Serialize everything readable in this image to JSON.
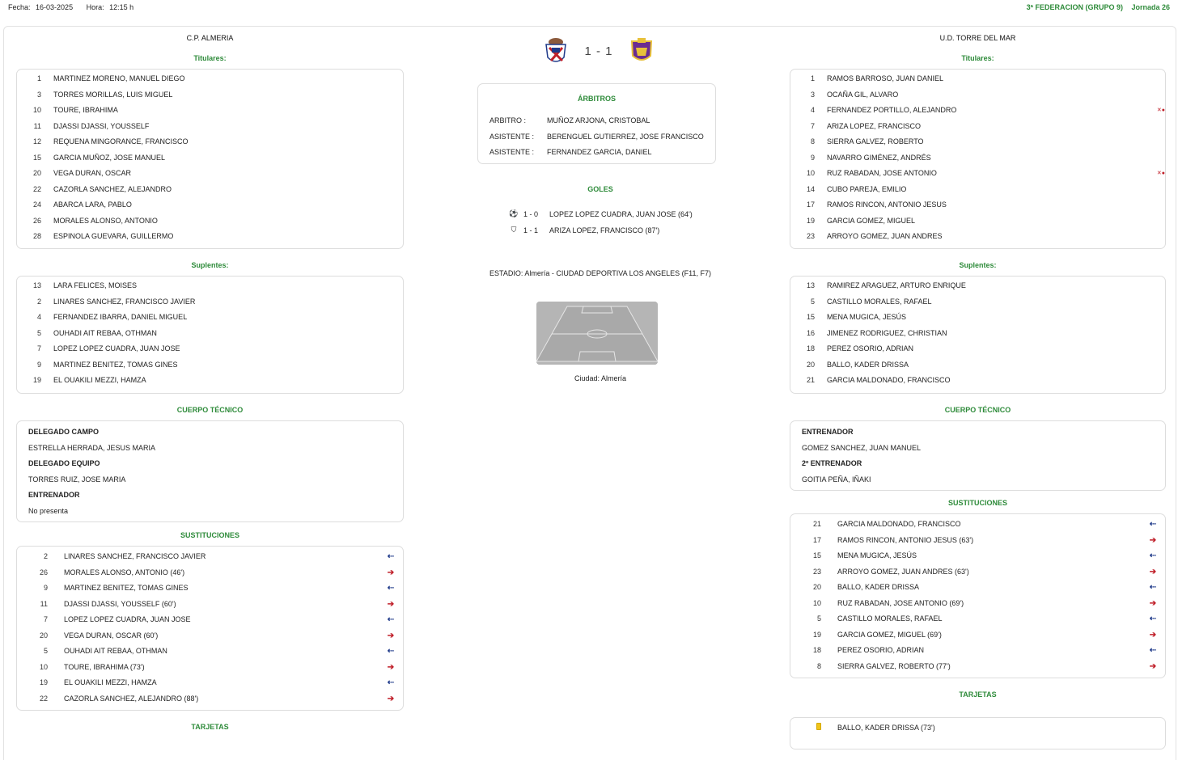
{
  "header": {
    "fecha_label": "Fecha:",
    "fecha": "16-03-2025",
    "hora_label": "Hora:",
    "hora": "12:15 h",
    "competition": "3ª FEDERACION (GRUPO 9)",
    "jornada": "Jornada 26"
  },
  "match": {
    "home_team": "C.P. ALMERIA",
    "away_team": "U.D. TORRE DEL MAR",
    "score": "1 - 1"
  },
  "labels": {
    "titulares": "Titulares:",
    "suplentes": "Suplentes:",
    "cuerpo_tecnico": "CUERPO TÉCNICO",
    "sustituciones": "SUSTITUCIONES",
    "tarjetas": "TARJETAS",
    "arbitros": "ÁRBITROS",
    "goles": "GOLES"
  },
  "home": {
    "starters": [
      {
        "num": "1",
        "name": "MARTINEZ MORENO, MANUEL DIEGO"
      },
      {
        "num": "3",
        "name": "TORRES MORILLAS, LUIS MIGUEL"
      },
      {
        "num": "10",
        "name": "TOURE, IBRAHIMA"
      },
      {
        "num": "11",
        "name": "DJASSI DJASSI, YOUSSELF"
      },
      {
        "num": "12",
        "name": "REQUENA MINGORANCE, FRANCISCO"
      },
      {
        "num": "15",
        "name": "GARCIA MUÑOZ, JOSE MANUEL"
      },
      {
        "num": "20",
        "name": "VEGA DURAN, OSCAR"
      },
      {
        "num": "22",
        "name": "CAZORLA SANCHEZ, ALEJANDRO"
      },
      {
        "num": "24",
        "name": "ABARCA LARA, PABLO"
      },
      {
        "num": "26",
        "name": "MORALES ALONSO, ANTONIO"
      },
      {
        "num": "28",
        "name": "ESPINOLA GUEVARA, GUILLERMO"
      }
    ],
    "subs": [
      {
        "num": "13",
        "name": "LARA FELICES, MOISES"
      },
      {
        "num": "2",
        "name": "LINARES SANCHEZ, FRANCISCO JAVIER"
      },
      {
        "num": "4",
        "name": "FERNANDEZ IBARRA, DANIEL MIGUEL"
      },
      {
        "num": "5",
        "name": "OUHADI AIT REBAA, OTHMAN"
      },
      {
        "num": "7",
        "name": "LOPEZ LOPEZ CUADRA, JUAN JOSE"
      },
      {
        "num": "9",
        "name": "MARTINEZ BENITEZ, TOMAS GINES"
      },
      {
        "num": "19",
        "name": "EL OUAKILI MEZZI, HAMZA"
      }
    ],
    "staff": [
      {
        "role": "DELEGADO CAMPO",
        "name": "ESTRELLA HERRADA, JESUS MARIA"
      },
      {
        "role": "DELEGADO EQUIPO",
        "name": "TORRES RUIZ, JOSE MARIA"
      },
      {
        "role": "ENTRENADOR",
        "name": "No presenta"
      }
    ],
    "substitutions": [
      {
        "num": "2",
        "name": "LINARES SANCHEZ, FRANCISCO JAVIER",
        "dir": "in",
        "arrow": "⇠"
      },
      {
        "num": "26",
        "name": "MORALES ALONSO, ANTONIO (46')",
        "dir": "out",
        "arrow": "➔"
      },
      {
        "num": "9",
        "name": "MARTINEZ BENITEZ, TOMAS GINES",
        "dir": "in",
        "arrow": "⇠"
      },
      {
        "num": "11",
        "name": "DJASSI DJASSI, YOUSSELF (60')",
        "dir": "out",
        "arrow": "➔"
      },
      {
        "num": "7",
        "name": "LOPEZ LOPEZ CUADRA, JUAN JOSE",
        "dir": "in",
        "arrow": "⇠"
      },
      {
        "num": "20",
        "name": "VEGA DURAN, OSCAR (60')",
        "dir": "out",
        "arrow": "➔"
      },
      {
        "num": "5",
        "name": "OUHADI AIT REBAA, OTHMAN",
        "dir": "in",
        "arrow": "⇠"
      },
      {
        "num": "10",
        "name": "TOURE, IBRAHIMA (73')",
        "dir": "out",
        "arrow": "➔"
      },
      {
        "num": "19",
        "name": "EL OUAKILI MEZZI, HAMZA",
        "dir": "in",
        "arrow": "⇠"
      },
      {
        "num": "22",
        "name": "CAZORLA SANCHEZ, ALEJANDRO (88')",
        "dir": "out",
        "arrow": "➔"
      }
    ]
  },
  "away": {
    "starters": [
      {
        "num": "1",
        "name": "RAMOS BARROSO, JUAN DANIEL"
      },
      {
        "num": "3",
        "name": "OCAÑA GIL, ALVARO"
      },
      {
        "num": "4",
        "name": "FERNANDEZ PORTILLO, ALEJANDRO",
        "icon": "captain-icon"
      },
      {
        "num": "7",
        "name": "ARIZA LOPEZ, FRANCISCO"
      },
      {
        "num": "8",
        "name": "SIERRA GALVEZ, ROBERTO"
      },
      {
        "num": "9",
        "name": "NAVARRO GIMÉNEZ, ANDRÉS"
      },
      {
        "num": "10",
        "name": "RUZ RABADAN, JOSE ANTONIO",
        "icon": "captain-icon"
      },
      {
        "num": "14",
        "name": "CUBO PAREJA, EMILIO"
      },
      {
        "num": "17",
        "name": "RAMOS RINCON, ANTONIO JESUS"
      },
      {
        "num": "19",
        "name": "GARCIA GOMEZ, MIGUEL"
      },
      {
        "num": "23",
        "name": "ARROYO GOMEZ, JUAN ANDRES"
      }
    ],
    "subs": [
      {
        "num": "13",
        "name": "RAMIREZ ARAGUEZ, ARTURO ENRIQUE"
      },
      {
        "num": "5",
        "name": "CASTILLO MORALES, RAFAEL"
      },
      {
        "num": "15",
        "name": "MENA MUGICA, JESÚS"
      },
      {
        "num": "16",
        "name": "JIMENEZ RODRIGUEZ, CHRISTIAN"
      },
      {
        "num": "18",
        "name": "PEREZ OSORIO, ADRIAN"
      },
      {
        "num": "20",
        "name": "BALLO, KADER DRISSA"
      },
      {
        "num": "21",
        "name": "GARCIA MALDONADO, FRANCISCO"
      }
    ],
    "staff": [
      {
        "role": "ENTRENADOR",
        "name": "GOMEZ SANCHEZ, JUAN MANUEL"
      },
      {
        "role": "2º ENTRENADOR",
        "name": "GOITIA PEÑA, IÑAKI"
      }
    ],
    "substitutions": [
      {
        "num": "21",
        "name": "GARCIA MALDONADO, FRANCISCO",
        "dir": "in",
        "arrow": "⇠"
      },
      {
        "num": "17",
        "name": "RAMOS RINCON, ANTONIO JESUS (63')",
        "dir": "out",
        "arrow": "➔"
      },
      {
        "num": "15",
        "name": "MENA MUGICA, JESÚS",
        "dir": "in",
        "arrow": "⇠"
      },
      {
        "num": "23",
        "name": "ARROYO GOMEZ, JUAN ANDRES (63')",
        "dir": "out",
        "arrow": "➔"
      },
      {
        "num": "20",
        "name": "BALLO, KADER DRISSA",
        "dir": "in",
        "arrow": "⇠"
      },
      {
        "num": "10",
        "name": "RUZ RABADAN, JOSE ANTONIO (69')",
        "dir": "out",
        "arrow": "➔"
      },
      {
        "num": "5",
        "name": "CASTILLO MORALES, RAFAEL",
        "dir": "in",
        "arrow": "⇠"
      },
      {
        "num": "19",
        "name": "GARCIA GOMEZ, MIGUEL (69')",
        "dir": "out",
        "arrow": "➔"
      },
      {
        "num": "18",
        "name": "PEREZ OSORIO, ADRIAN",
        "dir": "in",
        "arrow": "⇠"
      },
      {
        "num": "8",
        "name": "SIERRA GALVEZ, ROBERTO (77')",
        "dir": "out",
        "arrow": "➔"
      }
    ],
    "cards": [
      {
        "name": "BALLO, KADER DRISSA (73')",
        "type": "yellow-card-icon"
      }
    ]
  },
  "referees": [
    {
      "role": "ARBITRO :",
      "name": "MUÑOZ ARJONA, CRISTOBAL"
    },
    {
      "role": "ASISTENTE :",
      "name": "BERENGUEL GUTIERREZ, JOSE FRANCISCO"
    },
    {
      "role": "ASISTENTE :",
      "name": "FERNANDEZ GARCIA, DANIEL"
    }
  ],
  "goals": [
    {
      "icon": "⚽",
      "score": "1 - 0",
      "scorer": "LOPEZ LOPEZ CUADRA, JUAN JOSE (64')"
    },
    {
      "icon": "⛉",
      "score": "1 - 1",
      "scorer": "ARIZA LOPEZ, FRANCISCO (87')"
    }
  ],
  "venue": {
    "stadium": "ESTADIO: Almería - CIUDAD DEPORTIVA LOS ANGELES (F11, F7)",
    "city": "Ciudad: Almería"
  }
}
